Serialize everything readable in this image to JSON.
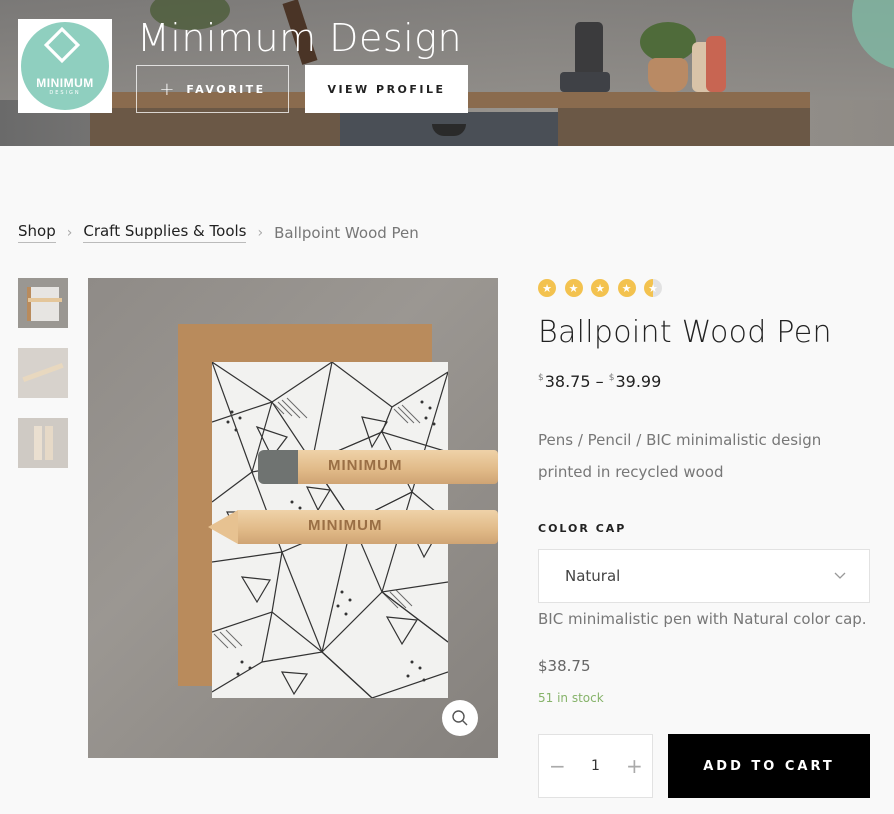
{
  "header": {
    "shop_name": "Minimum Design",
    "logo_text": "MINIMUM",
    "logo_subtext": "DESIGN",
    "favorite_label": "FAVORITE",
    "view_profile_label": "VIEW PROFILE"
  },
  "breadcrumb": {
    "items": [
      "Shop",
      "Craft Supplies & Tools"
    ],
    "current": "Ballpoint Wood Pen"
  },
  "gallery": {
    "thumbnails": [
      "thumb-1",
      "thumb-2",
      "thumb-3"
    ],
    "pencil_stamp": "MINIMUM"
  },
  "product": {
    "rating": 4.5,
    "rating_max": 5,
    "title": "Ballpoint Wood Pen",
    "currency_symbol": "$",
    "price_min": "38.75",
    "price_sep": "–",
    "price_max": "39.99",
    "description": "Pens / Pencil / BIC minimalistic design printed in recycled wood",
    "option_label": "COLOR CAP",
    "option_selected": "Natural",
    "variation_description": "BIC minimalistic pen with Natural color cap.",
    "variation_price": "$38.75",
    "stock": "51 in stock",
    "quantity": "1",
    "add_to_cart_label": "ADD TO CART"
  },
  "icons": {
    "favorite": "plus-icon",
    "breadcrumb_separator": "chevron-right-icon",
    "zoom": "search-icon",
    "select": "chevron-down-icon",
    "qty_minus": "minus-icon",
    "qty_plus": "plus-icon",
    "star": "star-icon"
  },
  "colors": {
    "accent_stars": "#f3c24f",
    "stock_green": "#86b36a",
    "cta_background": "#000000",
    "logo_mint": "#8fcfbf"
  }
}
